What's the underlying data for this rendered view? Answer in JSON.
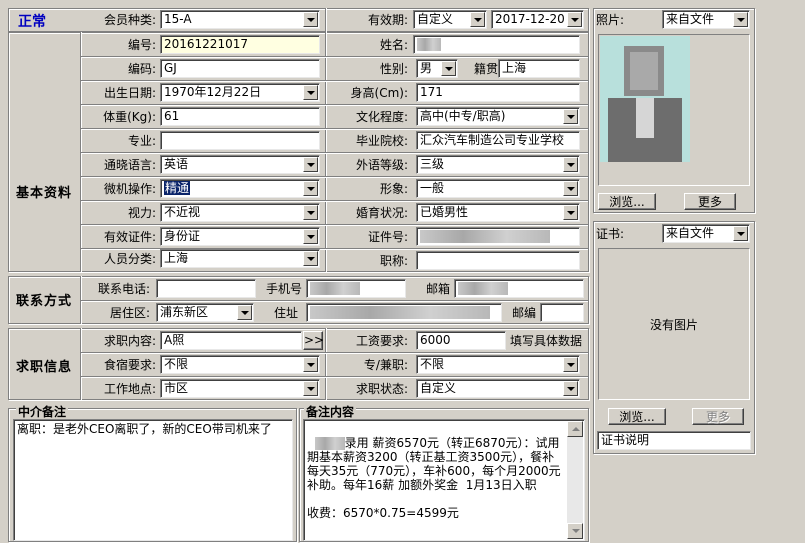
{
  "status": "正常",
  "top": {
    "member_type_label": "会员种类:",
    "member_type_value": "15-A",
    "validity_label": "有效期:",
    "validity_mode": "自定义",
    "validity_date": "2017-12-20"
  },
  "basic": {
    "section_title": "基本资料",
    "id_label": "编号:",
    "id_value": "20161221017",
    "name_label": "姓名:",
    "code_label": "编码:",
    "code_value": "GJ",
    "gender_label": "性别:",
    "gender_value": "男",
    "native_label": "籍贯",
    "native_value": "上海",
    "birth_label": "出生日期:",
    "birth_value": "1970年12月22日",
    "height_label": "身高(Cm):",
    "height_value": "171",
    "weight_label": "体重(Kg):",
    "weight_value": "61",
    "education_label": "文化程度:",
    "education_value": "高中(中专/职高)",
    "major_label": "专业:",
    "major_value": "",
    "school_label": "毕业院校:",
    "school_value": "汇众汽车制造公司专业学校",
    "language_label": "通晓语言:",
    "language_value": "英语",
    "language_level_label": "外语等级:",
    "language_level_value": "三级",
    "computer_label": "微机操作:",
    "computer_value": "精通",
    "image_label": "形象:",
    "image_value": "一般",
    "vision_label": "视力:",
    "vision_value": "不近视",
    "marital_label": "婚育状况:",
    "marital_value": "已婚男性",
    "cert_label": "有效证件:",
    "cert_value": "身份证",
    "cert_no_label": "证件号:",
    "category_label": "人员分类:",
    "category_value": "上海",
    "title_label": "职称:",
    "title_value": ""
  },
  "contact": {
    "section_title": "联系方式",
    "phone_label": "联系电话:",
    "phone_value": "",
    "mobile_label": "手机号",
    "email_label": "邮箱",
    "district_label": "居住区:",
    "district_value": "浦东新区",
    "address_label": "住址",
    "zip_label": "邮编",
    "zip_value": ""
  },
  "job": {
    "section_title": "求职信息",
    "content_label": "求职内容:",
    "content_value": "A照",
    "more_btn": ">>",
    "salary_label": "工资要求:",
    "salary_value": "6000",
    "salary_hint": "填写具体数据",
    "board_label": "食宿要求:",
    "board_value": "不限",
    "fulltime_label": "专/兼职:",
    "fulltime_value": "不限",
    "location_label": "工作地点:",
    "location_value": "市区",
    "status_label": "求职状态:",
    "status_value": "自定义"
  },
  "notes": {
    "agent_title": "中介备注",
    "agent_text": "离职：是老外CEO离职了，新的CEO带司机来了",
    "remark_title": "备注内容",
    "remark_text": "录用 薪资6570元（转正6870元）：试用期基本薪资3200（转正基工资3500元），餐补每天35元（770元），车补600，每个月2000元补助。每年16薪 加额外奖金  1月13日入职\n\n收费：6570*0.75=4599元"
  },
  "photo": {
    "label": "照片:",
    "source": "来自文件",
    "browse_btn": "浏览...",
    "more_btn": "更多"
  },
  "cert_panel": {
    "label": "证书:",
    "source": "来自文件",
    "no_image": "没有图片",
    "browse_btn": "浏览...",
    "more_btn": "更多",
    "desc_value": "证书说明"
  }
}
